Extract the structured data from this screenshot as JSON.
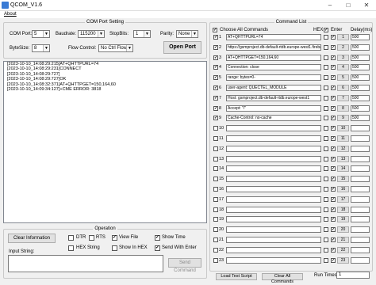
{
  "window": {
    "title": "QCOM_V1.6",
    "minimize": "–",
    "maximize": "□",
    "close": "✕"
  },
  "menu": {
    "about": "About"
  },
  "com_setting": {
    "legend": "COM Port Setting",
    "com_port_label": "COM Port:",
    "com_port_value": "5",
    "baudrate_label": "Baudrate:",
    "baudrate_value": "115200",
    "stopbits_label": "StopBits:",
    "stopbits_value": "1",
    "parity_label": "Parity:",
    "parity_value": "None",
    "bytesize_label": "ByteSize:",
    "bytesize_value": "8",
    "flow_label": "Flow Control:",
    "flow_value": "No Ctrl Flow",
    "open_port": "Open Port"
  },
  "log": [
    "[2023-10-10_14:08:29:215]AT+QHTTPURL=74",
    "[2023-10-10_14:08:29:231]CONNECT",
    "[2023-10-10_14:08:29:727]",
    "[2023-10-10_14:08:29:727]OK",
    "[2023-10-10_14:08:32:371]AT+QHTTPGET=150,164,60",
    "[2023-10-10_14:09:34:127]+CME ERROR: 3818"
  ],
  "operation": {
    "legend": "Operation",
    "clear_info": "Clear Information",
    "dtr": "DTR",
    "rts": "RTS",
    "view_file": "View File",
    "show_time": "Show Time",
    "hex_string": "HEX String",
    "show_in_hex": "Show In HEX",
    "send_with_enter": "Send With Enter",
    "input_label": "Input String:",
    "send_command": "Send Command"
  },
  "command_list": {
    "legend": "Command List",
    "choose_all": "Choose All Commands",
    "hex_header": "HEX",
    "enter_header": "Enter",
    "delay_header": "Delay(ms)",
    "commands": [
      {
        "n": "1",
        "text": "AT+QHTTPURL=74",
        "checked": "✓",
        "hex": "",
        "enter": "✓",
        "send": "1",
        "delay": "500"
      },
      {
        "n": "2",
        "text": "https://gsmproject.db-default-rtdb.europe-west1.firebasedatabase.app/",
        "checked": "✓",
        "hex": "",
        "enter": "✓",
        "send": "2",
        "delay": "500"
      },
      {
        "n": "3",
        "text": "AT+QHTTPGET=150,164,60",
        "checked": "✓",
        "hex": "",
        "enter": "✓",
        "send": "3",
        "delay": "500"
      },
      {
        "n": "4",
        "text": "Connection: close",
        "checked": "✓",
        "hex": "",
        "enter": "✓",
        "send": "4",
        "delay": "500"
      },
      {
        "n": "5",
        "text": "range: bytes=0-",
        "checked": "✓",
        "hex": "",
        "enter": "✓",
        "send": "5",
        "delay": "500"
      },
      {
        "n": "6",
        "text": "user-agent: QUECTEL_MODULE",
        "checked": "✓",
        "hex": "",
        "enter": "✓",
        "send": "6",
        "delay": "500"
      },
      {
        "n": "7",
        "text": "Host: gsmproject.db-default-rtdb.europe-west1",
        "checked": "✓",
        "hex": "",
        "enter": "✓",
        "send": "7",
        "delay": "500"
      },
      {
        "n": "8",
        "text": "Accept: \"/\"",
        "checked": "✓",
        "hex": "",
        "enter": "✓",
        "send": "8",
        "delay": "500"
      },
      {
        "n": "9",
        "text": "Cache-Control: no-cache",
        "checked": "✓",
        "hex": "",
        "enter": "✓",
        "send": "9",
        "delay": "500"
      },
      {
        "n": "10",
        "text": "",
        "checked": "",
        "hex": "",
        "enter": "✓",
        "send": "10",
        "delay": ""
      },
      {
        "n": "11",
        "text": "",
        "checked": "",
        "hex": "",
        "enter": "✓",
        "send": "11",
        "delay": ""
      },
      {
        "n": "12",
        "text": "",
        "checked": "",
        "hex": "",
        "enter": "✓",
        "send": "12",
        "delay": ""
      },
      {
        "n": "13",
        "text": "",
        "checked": "",
        "hex": "",
        "enter": "✓",
        "send": "13",
        "delay": ""
      },
      {
        "n": "14",
        "text": "",
        "checked": "",
        "hex": "",
        "enter": "✓",
        "send": "14",
        "delay": ""
      },
      {
        "n": "15",
        "text": "",
        "checked": "",
        "hex": "",
        "enter": "✓",
        "send": "15",
        "delay": ""
      },
      {
        "n": "16",
        "text": "",
        "checked": "",
        "hex": "",
        "enter": "✓",
        "send": "16",
        "delay": ""
      },
      {
        "n": "17",
        "text": "",
        "checked": "",
        "hex": "",
        "enter": "✓",
        "send": "17",
        "delay": ""
      },
      {
        "n": "18",
        "text": "",
        "checked": "",
        "hex": "",
        "enter": "✓",
        "send": "18",
        "delay": ""
      },
      {
        "n": "19",
        "text": "",
        "checked": "",
        "hex": "",
        "enter": "✓",
        "send": "19",
        "delay": ""
      },
      {
        "n": "20",
        "text": "",
        "checked": "",
        "hex": "",
        "enter": "✓",
        "send": "20",
        "delay": ""
      },
      {
        "n": "21",
        "text": "",
        "checked": "",
        "hex": "",
        "enter": "✓",
        "send": "21",
        "delay": ""
      },
      {
        "n": "22",
        "text": "",
        "checked": "",
        "hex": "",
        "enter": "✓",
        "send": "22",
        "delay": ""
      },
      {
        "n": "23",
        "text": "",
        "checked": "",
        "hex": "",
        "enter": "✓",
        "send": "23",
        "delay": ""
      }
    ],
    "load_script": "Load Test Script",
    "clear_all": "Clear All Commands",
    "run_times_label": "Run Times:",
    "run_times_value": "1"
  }
}
